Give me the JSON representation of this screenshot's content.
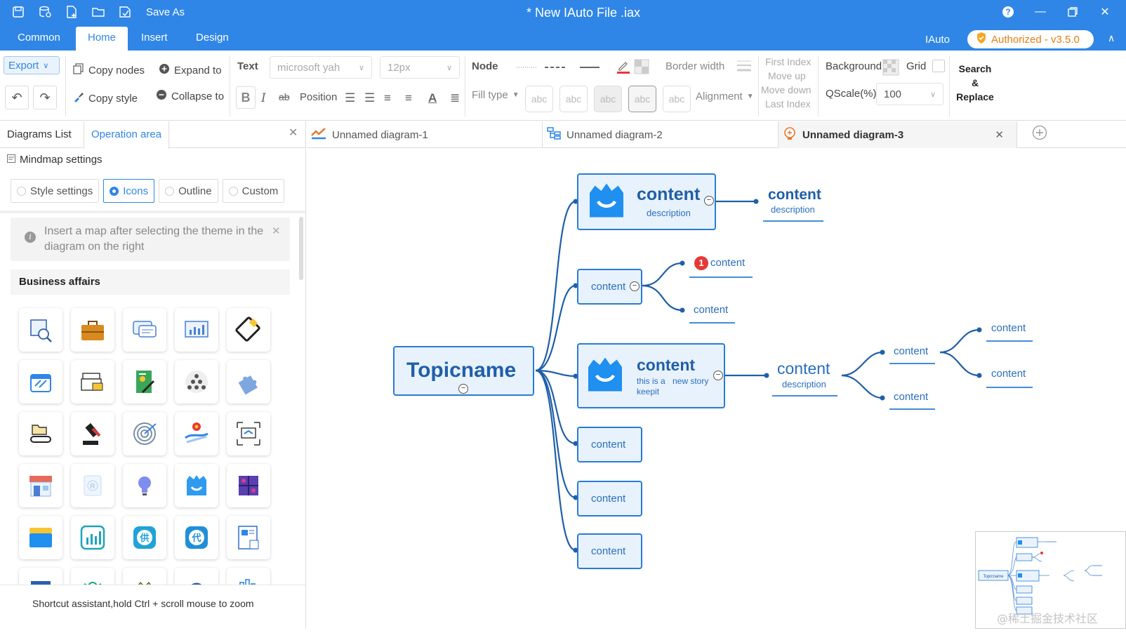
{
  "window": {
    "title": "* New IAuto File .iax",
    "save_as": "Save As"
  },
  "menu": {
    "tabs": [
      "Common",
      "Home",
      "Insert",
      "Design"
    ],
    "active_tab": "Home",
    "user": "IAuto",
    "license": "Authorized - v3.5.0"
  },
  "toolbar": {
    "export": "Export",
    "copy_nodes": "Copy nodes",
    "copy_style": "Copy style",
    "expand_to": "Expand to",
    "collapse_to": "Collapse to",
    "text_label": "Text",
    "font_family": "microsoft yah",
    "font_size": "12px",
    "bold": "B",
    "italic": "I",
    "strike": "ab",
    "position": "Position",
    "node_label": "Node",
    "border_width": "Border width",
    "fill_type": "Fill type",
    "alignment": "Alignment",
    "abc": "abc",
    "first_index": "First Index",
    "move_up": "Move up",
    "move_down": "Move down",
    "last_index": "Last Index",
    "background": "Background",
    "grid": "Grid",
    "scale_label": "QScale(%)",
    "scale_value": "100",
    "search_1": "Search",
    "search_2": "&",
    "search_3": "Replace"
  },
  "left_panel": {
    "tabs": [
      "Diagrams List",
      "Operation area"
    ],
    "active_tab": "Operation area",
    "settings_title": "Mindmap settings",
    "radio_options": [
      "Style settings",
      "Icons",
      "Outline",
      "Custom"
    ],
    "selected_option": "Icons",
    "notice": "Insert a map after selecting the theme in the diagram on the right",
    "category": "Business affairs",
    "icons": [
      "document-search-icon",
      "briefcase-icon",
      "chat-icon",
      "chart-screen-icon",
      "payment-card-icon",
      "storefront-icon",
      "cash-register-icon",
      "certificate-pen-icon",
      "team-pyramid-icon",
      "puzzle-icon",
      "folder-hand-icon",
      "gavel-icon",
      "target-icon",
      "route-plan-icon",
      "screen-network-icon",
      "shop-icon",
      "r-badge-icon",
      "lightbulb-icon",
      "shopping-bag-icon",
      "puzzle-piece-icon",
      "stack-icon",
      "bar-chart-icon",
      "supply-icon",
      "agent-icon",
      "news-report-icon"
    ],
    "footer": "Shortcut assistant,hold Ctrl + scroll mouse to zoom"
  },
  "doc_tabs": [
    "Unnamed diagram-1",
    "Unnamed diagram-2",
    "Unnamed diagram-3"
  ],
  "active_doc": "Unnamed diagram-3",
  "mindmap": {
    "root": "Topicname",
    "n1_title": "content",
    "n1_desc": "description",
    "n1_child_title": "content",
    "n1_child_desc": "description",
    "n2": "content",
    "n2_badge": "1",
    "n2_child_a": "content",
    "n2_child_b": "content",
    "n3_title": "content",
    "n3_desc_a": "this is a",
    "n3_desc_b": "new story",
    "n3_desc_c": "keepit",
    "n3_child_title": "content",
    "n3_child_desc": "description",
    "n3_gc_1": "content",
    "n3_gc_2": "content",
    "n3_ggc_1": "content",
    "n3_ggc_2": "content",
    "n4": "content",
    "n5": "content",
    "n6": "content"
  },
  "minimap": {
    "root": "Topicname"
  },
  "watermark": "@稀土掘金技术社区",
  "colors": {
    "brand": "#2f86e6",
    "node_border": "#2a7bd4",
    "node_fill": "#e8f2fd",
    "badge": "#e53935",
    "license": "#e87c12"
  }
}
